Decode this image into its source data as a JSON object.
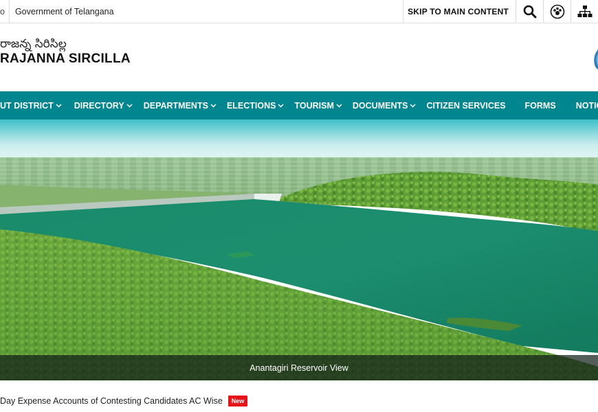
{
  "topbar": {
    "stub_text": "o",
    "gov_label": "Government of Telangana",
    "skip_label": "SKIP TO MAIN CONTENT",
    "icons": [
      "search-icon",
      "accessibility-icon",
      "sitemap-icon"
    ]
  },
  "header": {
    "telugu_name": "రాజన్న సిరిసిల్ల",
    "english_name": "RAJANNA SIRCILLA"
  },
  "nav": {
    "items": [
      {
        "label": "UT DISTRICT",
        "dropdown": true
      },
      {
        "label": "DIRECTORY",
        "dropdown": true
      },
      {
        "label": "DEPARTMENTS",
        "dropdown": true
      },
      {
        "label": "ELECTIONS",
        "dropdown": true
      },
      {
        "label": "TOURISM",
        "dropdown": true
      },
      {
        "label": "DOCUMENTS",
        "dropdown": true
      },
      {
        "label": "CITIZEN SERVICES",
        "dropdown": false
      },
      {
        "label": "FORMS",
        "dropdown": false
      },
      {
        "label": "NOTICES",
        "dropdown": true
      }
    ]
  },
  "hero": {
    "caption": "Anantagiri Reservoir View"
  },
  "news": {
    "text": "Day Expense Accounts of Contesting Candidates AC Wise",
    "badge": "New"
  },
  "colors": {
    "nav_bg": "#01858f",
    "badge_bg": "#e5121a",
    "water": "#1d8f6e"
  }
}
